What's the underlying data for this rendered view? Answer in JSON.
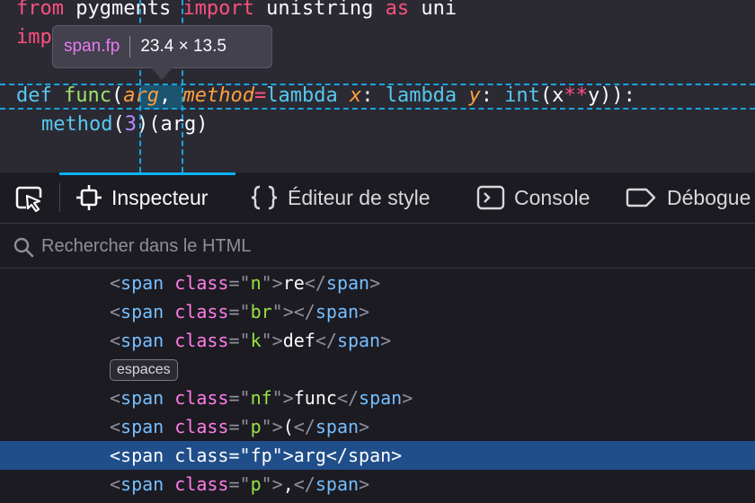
{
  "code": {
    "line1": [
      {
        "t": "from",
        "c": "kw"
      },
      {
        "t": " pygments ",
        "c": ""
      },
      {
        "t": "import",
        "c": "kw"
      },
      {
        "t": " unistring ",
        "c": ""
      },
      {
        "t": "as",
        "c": "kw"
      },
      {
        "t": " uni",
        "c": ""
      }
    ],
    "line2": [
      {
        "t": "imp",
        "c": "kw"
      }
    ],
    "line3": [
      {
        "t": "def",
        "c": "kd"
      },
      {
        "t": " ",
        "c": ""
      },
      {
        "t": "func",
        "c": "fn"
      },
      {
        "t": "(",
        "c": ""
      },
      {
        "t": "arg",
        "c": "par"
      },
      {
        "t": ", ",
        "c": ""
      },
      {
        "t": "method",
        "c": "par"
      },
      {
        "t": "=",
        "c": "op"
      },
      {
        "t": "lambda",
        "c": "kd"
      },
      {
        "t": " ",
        "c": ""
      },
      {
        "t": "x",
        "c": "par"
      },
      {
        "t": ": ",
        "c": ""
      },
      {
        "t": "lambda",
        "c": "kd"
      },
      {
        "t": " ",
        "c": ""
      },
      {
        "t": "y",
        "c": "par"
      },
      {
        "t": ": ",
        "c": ""
      },
      {
        "t": "int",
        "c": "kd"
      },
      {
        "t": "(x",
        "c": ""
      },
      {
        "t": "**",
        "c": "op"
      },
      {
        "t": "y)): ",
        "c": ""
      }
    ],
    "line4": [
      {
        "t": "method",
        "c": "kd"
      },
      {
        "t": "(",
        "c": ""
      },
      {
        "t": "3",
        "c": "num"
      },
      {
        "t": ")(arg)",
        "c": ""
      }
    ]
  },
  "tooltip": {
    "tag": "span.fp",
    "dimensions": "23.4 × 13.5"
  },
  "toolbar": {
    "tabs": [
      {
        "label": "Inspecteur",
        "icon": "inspector-icon",
        "selected": true
      },
      {
        "label": "Éditeur de style",
        "icon": "style-editor-icon",
        "selected": false
      },
      {
        "label": "Console",
        "icon": "console-icon",
        "selected": false
      },
      {
        "label": "Débogue",
        "icon": "debugger-icon",
        "selected": false
      }
    ]
  },
  "search": {
    "placeholder": "Rechercher dans le HTML",
    "value": ""
  },
  "tree": {
    "rows": [
      {
        "kind": "tag",
        "cls": "n",
        "text": "re",
        "selected": false
      },
      {
        "kind": "tag",
        "cls": "br",
        "text": "",
        "selected": false
      },
      {
        "kind": "tag",
        "cls": "k",
        "text": "def",
        "selected": false
      },
      {
        "kind": "badge",
        "label": "espaces"
      },
      {
        "kind": "tag",
        "cls": "nf",
        "text": "func",
        "selected": false
      },
      {
        "kind": "tag",
        "cls": "p",
        "text": "(",
        "selected": false
      },
      {
        "kind": "tag",
        "cls": "fp",
        "text": "arg",
        "selected": true
      },
      {
        "kind": "tag",
        "cls": "p",
        "text": ",",
        "selected": false
      }
    ],
    "tag_name": "span",
    "attr_name": "class"
  },
  "colors": {
    "accent": "#00b3f4",
    "selected_row": "#204e8a",
    "guide": "#19a3e0"
  }
}
